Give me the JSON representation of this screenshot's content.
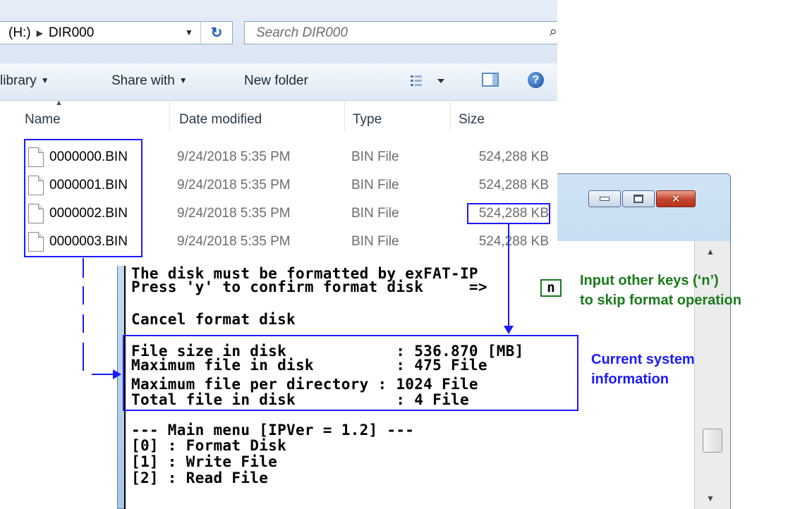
{
  "explorer": {
    "address": {
      "drive": "(H:)",
      "folder": "DIR000"
    },
    "search_placeholder": "Search DIR000",
    "toolbar": {
      "library": "library",
      "share_with": "Share with",
      "new_folder": "New folder"
    },
    "columns": {
      "name": "Name",
      "date": "Date modified",
      "type": "Type",
      "size": "Size"
    },
    "files": [
      {
        "name": "0000000.BIN",
        "date": "9/24/2018 5:35 PM",
        "type": "BIN File",
        "size": "524,288 KB"
      },
      {
        "name": "0000001.BIN",
        "date": "9/24/2018 5:35 PM",
        "type": "BIN File",
        "size": "524,288 KB"
      },
      {
        "name": "0000002.BIN",
        "date": "9/24/2018 5:35 PM",
        "type": "BIN File",
        "size": "524,288 KB"
      },
      {
        "name": "0000003.BIN",
        "date": "9/24/2018 5:35 PM",
        "type": "BIN File",
        "size": "524,288 KB"
      }
    ]
  },
  "console": {
    "lines": [
      "The disk must be formatted by exFAT-IP",
      "Press 'y' to confirm format disk     =>",
      "",
      "Cancel format disk",
      "",
      "File size in disk            : 536.870 [MB]",
      "Maximum file in disk         : 475 File",
      "Maximum file per directory : 1024 File",
      "Total file in disk           : 4 File",
      "",
      "--- Main menu [IPVer = 1.2] ---",
      "[0] : Format Disk",
      "[1] : Write File",
      "[2] : Read File"
    ],
    "key_input": "n"
  },
  "annotations": {
    "skip_format_line1": "Input other keys (‘n’)",
    "skip_format_line2": "to skip format operation",
    "system_info_line1": "Current system",
    "system_info_line2": "information"
  },
  "colors": {
    "annotation_blue": "#1a1aff",
    "annotation_green": "#1a7a1a"
  }
}
